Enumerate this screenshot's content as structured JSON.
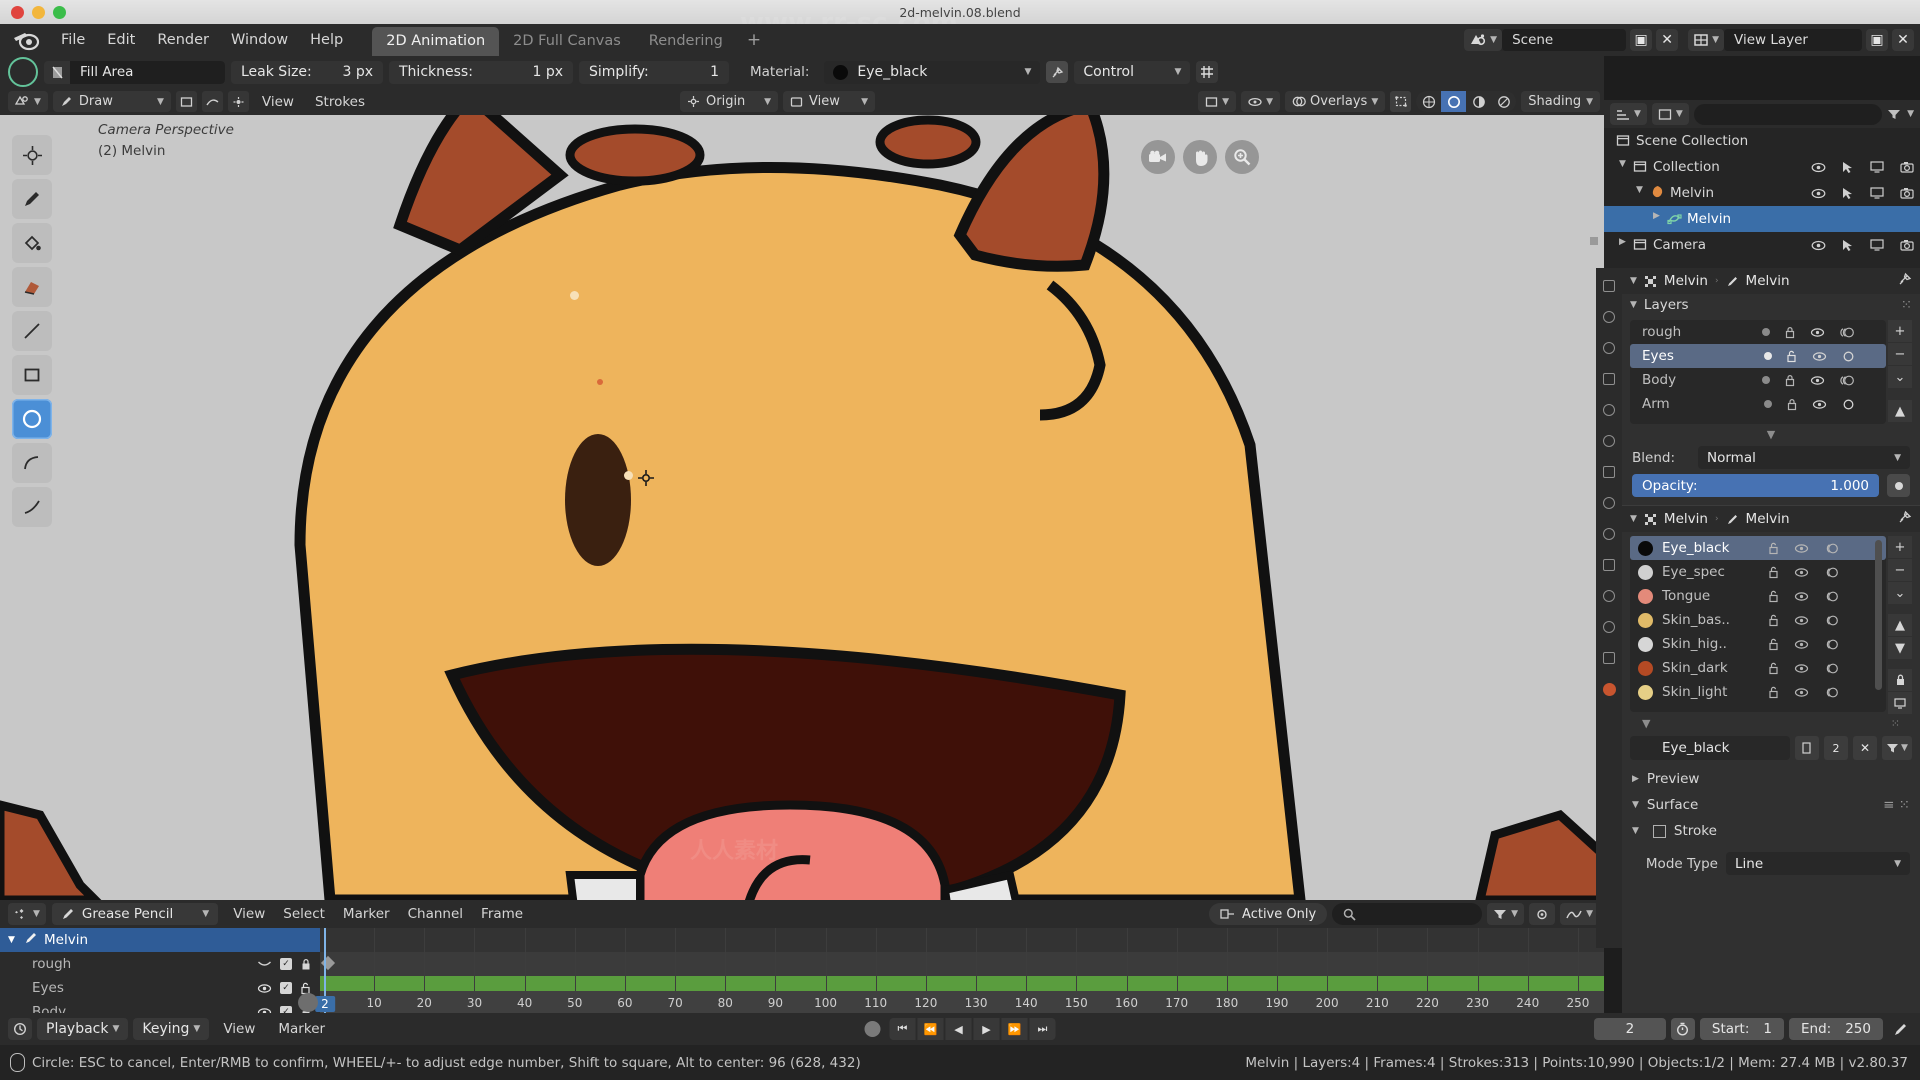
{
  "window": {
    "title": "2d-melvin.08.blend",
    "watermark": "www.rr-sc.com"
  },
  "topbar": {
    "menus": [
      "File",
      "Edit",
      "Render",
      "Window",
      "Help"
    ],
    "workspaces": [
      {
        "label": "2D Animation",
        "active": true
      },
      {
        "label": "2D Full Canvas",
        "active": false
      },
      {
        "label": "Rendering",
        "active": false
      }
    ],
    "add_workspace": "+",
    "scene_name": "Scene",
    "view_layer_name": "View Layer",
    "scene_icon": "scene-icon",
    "viewlayer_icon": "view-layer-icon"
  },
  "toolsettings": {
    "brush_name": "Fill Area",
    "leak_size_label": "Leak Size:",
    "leak_size_value": "3 px",
    "thickness_label": "Thickness:",
    "thickness_value": "1 px",
    "simplify_label": "Simplify:",
    "simplify_value": "1",
    "material_label": "Material:",
    "material_value": "Eye_black",
    "material_color": "#0a0a0a",
    "control_value": "Control"
  },
  "viewport_header": {
    "mode": "Draw",
    "menus": [
      "View",
      "Strokes"
    ],
    "origin": "Origin",
    "view": "View",
    "overlays": "Overlays",
    "shading": "Shading"
  },
  "viewport": {
    "camera_text": "Camera Perspective",
    "object_text": "(2) Melvin",
    "gizmos": [
      "camera-icon",
      "hand-icon",
      "zoom-icon"
    ],
    "tools": [
      "cursor-tool",
      "draw-tool",
      "fill-tool",
      "erase-tool",
      "line-tool",
      "box-tool",
      "circle-tool",
      "arc-tool",
      "curve-tool"
    ],
    "active_tool_index": 6,
    "colors": {
      "bg": "#c8c8c8",
      "skin_base": "#eeb45c",
      "skin_dark": "#a44b2b",
      "outline": "#111111",
      "mouth": "#3f1008",
      "tongue": "#ef7f77",
      "tooth": "#e8e8e8",
      "eye": "#3a2010"
    }
  },
  "outliner": {
    "filter_icon": "filter-icon",
    "rows": [
      {
        "label": "Scene Collection",
        "icon": "collection-icon",
        "indent": 0,
        "selected": false,
        "icons": []
      },
      {
        "label": "Collection",
        "icon": "collection-icon",
        "indent": 1,
        "selected": false,
        "icons": [
          "eye-icon",
          "cursor-icon",
          "screen-icon",
          "camera-icon"
        ]
      },
      {
        "label": "Melvin",
        "icon": "object-icon",
        "indent": 2,
        "selected": false,
        "icons": [
          "eye-icon",
          "cursor-icon",
          "screen-icon",
          "camera-icon"
        ]
      },
      {
        "label": "Melvin",
        "icon": "grease-pencil-icon",
        "indent": 3,
        "selected": true,
        "icons": []
      },
      {
        "label": "Camera",
        "icon": "camera-data-icon",
        "indent": 1,
        "selected": false,
        "icons": [
          "eye-icon",
          "cursor-icon",
          "screen-icon",
          "camera-icon"
        ]
      }
    ]
  },
  "properties": {
    "breadcrumb_object": "Melvin",
    "breadcrumb_data": "Melvin",
    "layers_section": "Layers",
    "layers": [
      {
        "name": "rough",
        "selected": false,
        "locked": true,
        "onion": true,
        "mask": false
      },
      {
        "name": "Eyes",
        "selected": true,
        "locked": false,
        "onion": true,
        "mask": true
      },
      {
        "name": "Body",
        "selected": false,
        "locked": true,
        "onion": true,
        "mask": false
      },
      {
        "name": "Arm",
        "selected": false,
        "locked": true,
        "onion": true,
        "mask": true
      }
    ],
    "layer_side_buttons": [
      "+",
      "−",
      "⌄",
      "▲",
      "▼"
    ],
    "blend_label": "Blend:",
    "blend_value": "Normal",
    "opacity_label": "Opacity:",
    "opacity_value": "1.000",
    "materials": [
      {
        "name": "Eye_black",
        "color": "#0a0a0a",
        "selected": true
      },
      {
        "name": "Eye_spec",
        "color": "#d0d0d0",
        "selected": false
      },
      {
        "name": "Tongue",
        "color": "#e38a7a",
        "selected": false
      },
      {
        "name": "Skin_bas..",
        "color": "#e0ba68",
        "selected": false
      },
      {
        "name": "Skin_hig..",
        "color": "#d6d6d6",
        "selected": false
      },
      {
        "name": "Skin_dark",
        "color": "#b44a24",
        "selected": false
      },
      {
        "name": "Skin_light",
        "color": "#e6cf86",
        "selected": false
      }
    ],
    "material_side_buttons": [
      "+",
      "−",
      "⌄",
      "▲",
      "▼",
      "lock-icon",
      "screen-icon"
    ],
    "active_material": "Eye_black",
    "active_material_color": "#0a0a0a",
    "sections": [
      {
        "label": "Preview",
        "open": false
      },
      {
        "label": "Surface",
        "open": true
      },
      {
        "label": "Stroke",
        "open": true
      }
    ],
    "mode_type_label": "Mode Type",
    "mode_type_value": "Line",
    "tabs": [
      "tool-tab",
      "render-tab",
      "output-tab",
      "viewlayer-tab",
      "scene-tab",
      "world-tab",
      "object-tab",
      "modifier-tab",
      "visual-effects-tab",
      "particles-tab",
      "physics-tab",
      "constraints-tab",
      "data-tab",
      "material-tab"
    ],
    "active_tab_index": 13
  },
  "dopesheet": {
    "editor_icon": "dopesheet-icon",
    "mode": "Grease Pencil",
    "menus": [
      "View",
      "Select",
      "Marker",
      "Channel",
      "Frame"
    ],
    "active_only": "Active Only",
    "search_placeholder": "",
    "filter_icon": "filter-icon",
    "channels": [
      {
        "label": "Melvin",
        "selected": true,
        "sub": false,
        "icons": []
      },
      {
        "label": "rough",
        "selected": false,
        "sub": true,
        "icons": [
          "onion-icon",
          "checkbox-on",
          "lock-closed"
        ]
      },
      {
        "label": "Eyes",
        "selected": false,
        "sub": true,
        "icons": [
          "eye-icon",
          "checkbox-on",
          "lock-open"
        ]
      },
      {
        "label": "Body",
        "selected": false,
        "sub": true,
        "icons": [
          "eye-icon",
          "checkbox-on",
          "lock-closed"
        ]
      }
    ],
    "ticks": [
      10,
      20,
      30,
      40,
      50,
      60,
      70,
      80,
      90,
      100,
      110,
      120,
      130,
      140,
      150,
      160,
      170,
      180,
      190,
      200,
      210,
      220,
      230,
      240,
      250
    ],
    "current_frame": "2",
    "track_color": "#5a9d3e"
  },
  "timeline": {
    "playback": "Playback",
    "keying": "Keying",
    "menus": [
      "View",
      "Marker"
    ],
    "transport": [
      "⏮",
      "⏪",
      "◀",
      "▶",
      "⏩",
      "⏭"
    ],
    "current_frame": "2",
    "start_label": "Start:",
    "start_value": "1",
    "end_label": "End:",
    "end_value": "250"
  },
  "statusbar": {
    "hint": "Circle: ESC to cancel, Enter/RMB to confirm, WHEEL/+- to adjust edge number, Shift to square, Alt to center: 96 (628, 432)",
    "stats": "Melvin | Layers:4 | Frames:4 | Strokes:313 | Points:10,990 | Objects:1/2 | Mem: 27.4 MB | v2.80.37"
  }
}
